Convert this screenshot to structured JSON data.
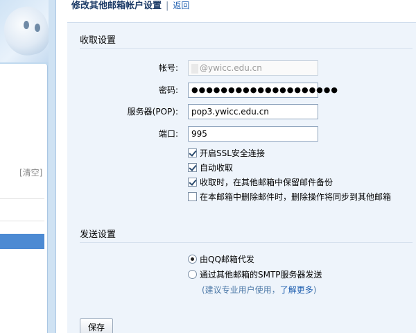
{
  "sidebar": {
    "clear_label": "[清空]"
  },
  "header": {
    "title": "修改其他邮箱帐户设置",
    "separator": "|",
    "back_label": "返回"
  },
  "receive": {
    "section_title": "收取设置",
    "account_label": "帐号:",
    "account_value": "@ywicc.edu.cn",
    "password_label": "密码:",
    "password_value": "●●●●●●●●●●●●●●●●●●●●",
    "server_label": "服务器(POP):",
    "server_value": "pop3.ywicc.edu.cn",
    "port_label": "端口:",
    "port_value": "995",
    "options": [
      {
        "label": "开启SSL安全连接",
        "checked": true
      },
      {
        "label": "自动收取",
        "checked": true
      },
      {
        "label": "收取时，在其他邮箱中保留邮件备份",
        "checked": true
      },
      {
        "label": "在本邮箱中删除邮件时，删除操作将同步到其他邮箱",
        "checked": false
      }
    ]
  },
  "send": {
    "section_title": "发送设置",
    "options": [
      {
        "label": "由QQ邮箱代发",
        "selected": true
      },
      {
        "label": "通过其他邮箱的SMTP服务器发送",
        "selected": false
      }
    ],
    "hint_prefix": "(建议专业用户使用，",
    "hint_link": "了解更多",
    "hint_suffix": ")"
  },
  "actions": {
    "save_label": "保存"
  }
}
